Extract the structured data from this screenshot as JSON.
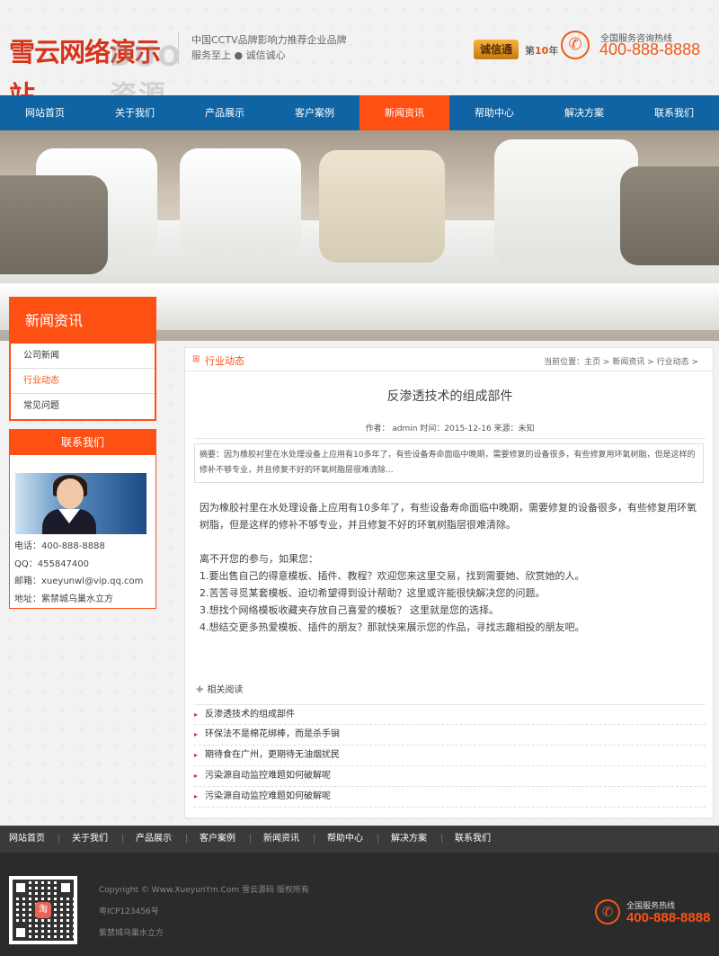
{
  "header": {
    "logo_text": "雪云网络演示站",
    "logo_watermark": "DUO资源",
    "slogan_line1": "中国CCTV品牌影响力推荐企业品牌",
    "slogan_line2": "服务至上 ● 诚信诚心",
    "badge_text": "诚信通",
    "year_prefix": "第",
    "year_number": "10",
    "year_suffix": "年",
    "hotline_label": "全国服务咨询热线",
    "hotline_number": "400-888-8888"
  },
  "nav": {
    "items": [
      "网站首页",
      "关于我们",
      "产品展示",
      "客户案例",
      "新闻资讯",
      "帮助中心",
      "解决方案",
      "联系我们"
    ],
    "active_index": 4
  },
  "sidebar": {
    "title": "新闻资讯",
    "items": [
      "公司新闻",
      "行业动态",
      "常见问题"
    ],
    "active_index": 1
  },
  "contact": {
    "title": "联系我们",
    "phone": "电话：400-888-8888",
    "qq": "QQ：455847400",
    "email": "邮箱：xueyunwl@vip.qq.com",
    "address": "地址：紫禁城乌巢水立方"
  },
  "main": {
    "section_title": "行业动态",
    "breadcrumb": "当前位置：主页 > 新闻资讯 > 行业动态 >",
    "article_title": "反渗透技术的组成部件",
    "meta": "作者： admin 时间：2015-12-16 来源：未知",
    "summary": "摘要：因为橡胶衬里在水处理设备上应用有10多年了，有些设备寿命面临中晚期，需要修复的设备很多，有些修复用环氧树脂，但是这样的修补不够专业，并且修复不好的环氧树脂层很难清除...",
    "paragraph1": "因为橡胶衬里在水处理设备上应用有10多年了，有些设备寿命面临中晚期，需要修复的设备很多，有些修复用环氧树脂，但是这样的修补不够专业，并且修复不好的环氧树脂层很难清除。",
    "intro": "离不开您的参与，如果您：",
    "points": [
      "1.要出售自己的得意模板、插件、教程？欢迎您来这里交易，找到需要她、欣赏她的人。",
      "2.苦苦寻觅某套模板、迫切希望得到设计帮助？这里或许能很快解决您的问题。",
      "3.想找个网络模板收藏夹存放自己喜爱的模板？ 这里就是您的选择。",
      "4.想结交更多热爱模板、插件的朋友？那就快来展示您的作品，寻找志趣相投的朋友吧。"
    ],
    "related_title": "相关阅读",
    "related": [
      "反渗透技术的组成部件",
      "环保法不是棉花绑棒，而是杀手锏",
      "期待食在广州，更期待无油烟扰民",
      "污染源自动监控难题如何破解呢",
      "污染源自动监控难题如何破解呢"
    ]
  },
  "footer": {
    "nav": [
      "网站首页",
      "关于我们",
      "产品展示",
      "客户案例",
      "新闻资讯",
      "帮助中心",
      "解决方案",
      "联系我们"
    ],
    "copyright": "Copyright © Www.XueyunYm.Com 雪云源码 版权所有",
    "icp": "粤ICP123456号",
    "address": "紫禁城乌巢水立方",
    "hotline_label": "全国服务热线",
    "hotline_number": "400-888-8888",
    "qr_badge": "淘"
  },
  "colors": {
    "accent": "#ff5014",
    "nav_blue": "#1164a4",
    "footer_dark": "#2b2b2b"
  }
}
